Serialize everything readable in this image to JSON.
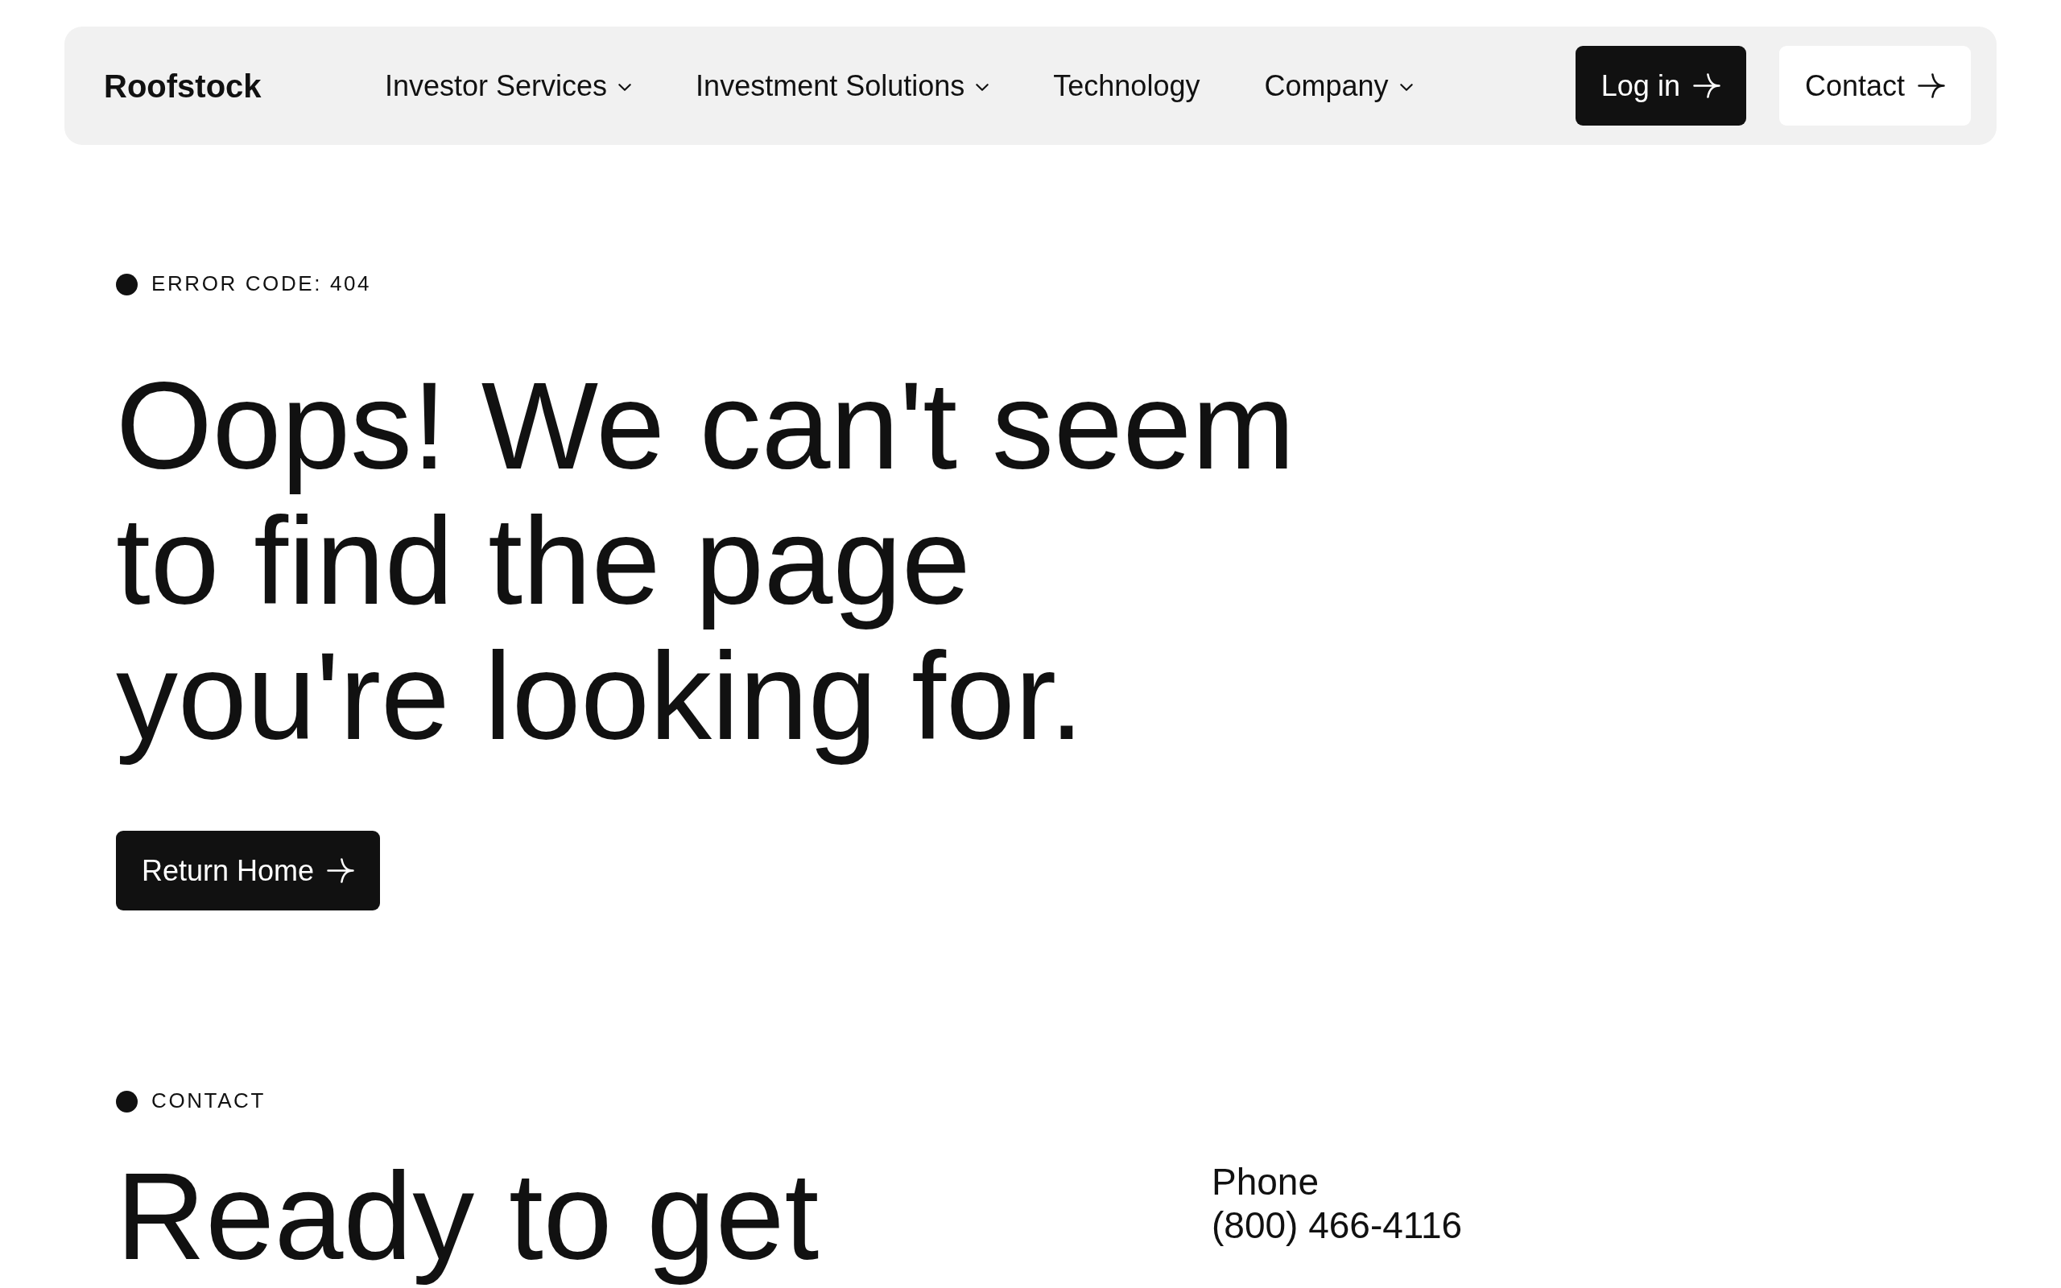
{
  "nav": {
    "logo": "Roofstock",
    "items": [
      {
        "label": "Investor Services",
        "has_menu": true
      },
      {
        "label": "Investment Solutions",
        "has_menu": true
      },
      {
        "label": "Technology",
        "has_menu": false
      },
      {
        "label": "Company",
        "has_menu": true
      }
    ],
    "buttons": [
      {
        "label": "Log in",
        "kind": "primary"
      },
      {
        "label": "Contact",
        "kind": "secondary"
      }
    ]
  },
  "error": {
    "eyebrow": "ERROR CODE: 404",
    "heading": "Oops! We can't seem to find the page you're looking for.",
    "button": {
      "label": "Return Home",
      "kind": "primary"
    }
  },
  "contact": {
    "eyebrow": "CONTACT",
    "heading": "Ready to get",
    "phone_label": "Phone",
    "phone": "(800) 466-4116"
  }
}
